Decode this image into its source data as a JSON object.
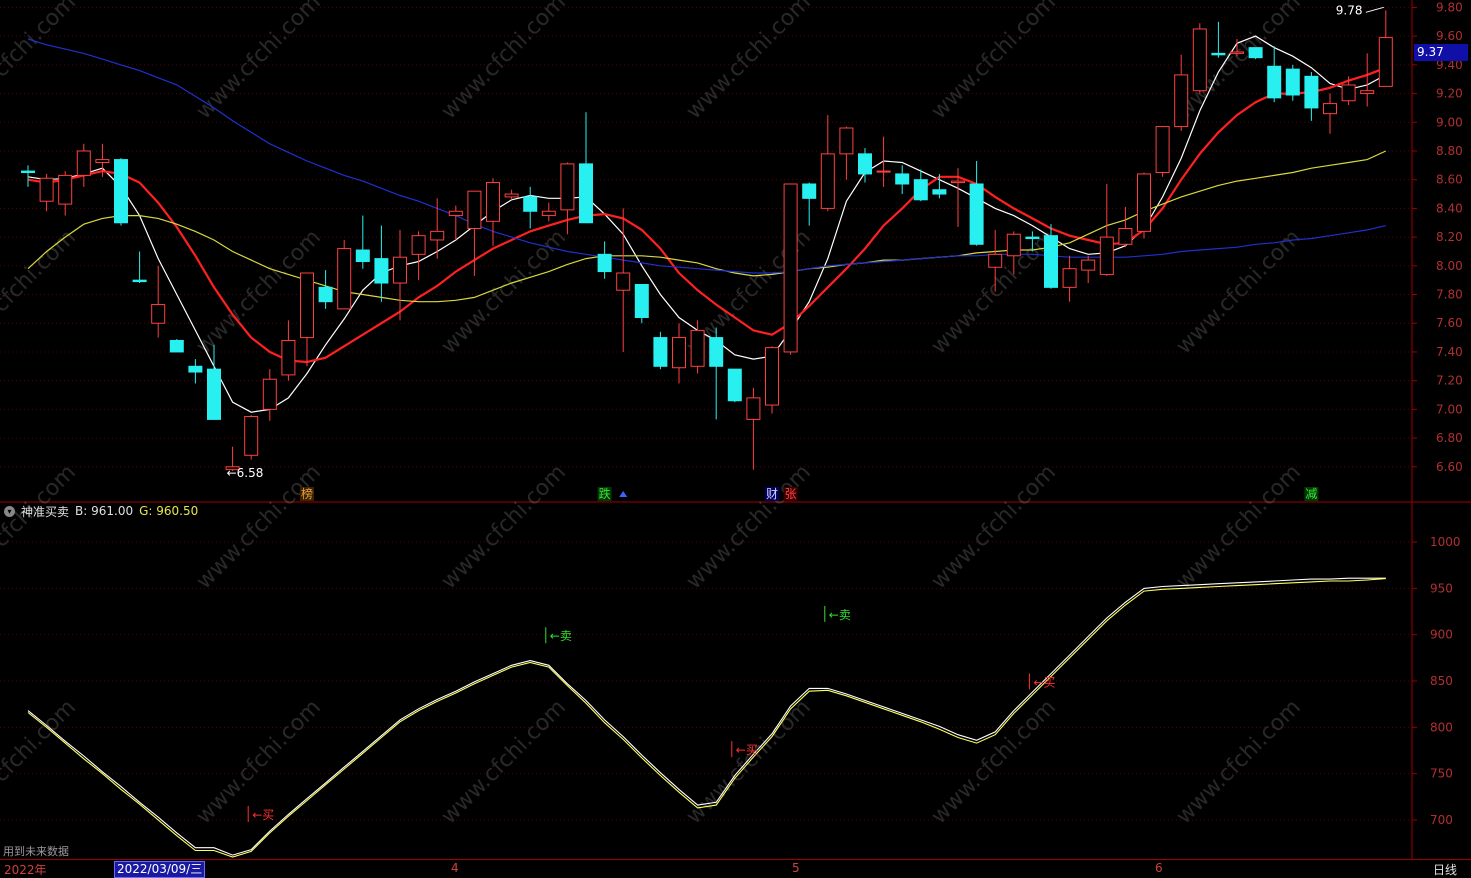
{
  "chart_data": [
    {
      "type": "candlestick",
      "ylim": [
        6.48,
        9.81
      ],
      "yticks": [
        6.6,
        6.8,
        7.0,
        7.2,
        7.4,
        7.6,
        7.8,
        8.0,
        8.2,
        8.4,
        8.6,
        8.8,
        9.0,
        9.2,
        9.4,
        9.6,
        9.8
      ],
      "last_price_label": "9.37",
      "high_annotation": "9.78",
      "low_annotation": "←6.58",
      "candles": [
        [
          8.66,
          8.65,
          8.7,
          8.55
        ],
        [
          8.45,
          8.61,
          8.64,
          8.38
        ],
        [
          8.43,
          8.63,
          8.66,
          8.35
        ],
        [
          8.63,
          8.8,
          8.85,
          8.55
        ],
        [
          8.72,
          8.74,
          8.85,
          8.62
        ],
        [
          8.74,
          8.3,
          8.75,
          8.28
        ],
        [
          7.9,
          7.89,
          8.1,
          7.88
        ],
        [
          7.6,
          7.73,
          8.0,
          7.5
        ],
        [
          7.48,
          7.4,
          7.49,
          7.4
        ],
        [
          7.3,
          7.26,
          7.35,
          7.18
        ],
        [
          7.28,
          6.93,
          7.45,
          6.93
        ],
        [
          6.58,
          6.6,
          6.74,
          6.57
        ],
        [
          6.68,
          6.95,
          6.96,
          6.65
        ],
        [
          7.0,
          7.21,
          7.28,
          6.92
        ],
        [
          7.24,
          7.48,
          7.62,
          7.2
        ],
        [
          7.5,
          7.95,
          7.95,
          7.3
        ],
        [
          7.85,
          7.75,
          7.97,
          7.7
        ],
        [
          7.7,
          8.12,
          8.18,
          7.7
        ],
        [
          8.11,
          8.03,
          8.35,
          7.98
        ],
        [
          8.05,
          7.88,
          8.28,
          7.75
        ],
        [
          7.88,
          8.06,
          8.25,
          7.62
        ],
        [
          8.08,
          8.21,
          8.24,
          7.9
        ],
        [
          8.18,
          8.24,
          8.47,
          8.05
        ],
        [
          8.35,
          8.38,
          8.42,
          8.18
        ],
        [
          8.26,
          8.52,
          8.52,
          7.93
        ],
        [
          8.31,
          8.58,
          8.61,
          8.14
        ],
        [
          8.48,
          8.5,
          8.53,
          8.46
        ],
        [
          8.48,
          8.38,
          8.55,
          8.26
        ],
        [
          8.35,
          8.38,
          8.44,
          8.31
        ],
        [
          8.39,
          8.71,
          8.72,
          8.22
        ],
        [
          8.71,
          8.3,
          9.07,
          8.3
        ],
        [
          8.08,
          7.96,
          8.17,
          7.91
        ],
        [
          7.83,
          7.95,
          8.4,
          7.4
        ],
        [
          7.87,
          7.64,
          7.87,
          7.6
        ],
        [
          7.5,
          7.3,
          7.54,
          7.28
        ],
        [
          7.29,
          7.5,
          7.6,
          7.18
        ],
        [
          7.3,
          7.55,
          7.62,
          7.25
        ],
        [
          7.5,
          7.3,
          7.57,
          6.93
        ],
        [
          7.28,
          7.06,
          7.28,
          7.05
        ],
        [
          6.93,
          7.08,
          7.15,
          6.58
        ],
        [
          7.03,
          7.43,
          7.44,
          6.97
        ],
        [
          7.4,
          8.57,
          8.57,
          7.38
        ],
        [
          8.57,
          8.47,
          8.58,
          8.28
        ],
        [
          8.4,
          8.78,
          9.05,
          8.38
        ],
        [
          8.78,
          8.96,
          8.97,
          8.6
        ],
        [
          8.78,
          8.64,
          8.82,
          8.58
        ],
        [
          8.66,
          8.66,
          8.9,
          8.55
        ],
        [
          8.64,
          8.57,
          8.7,
          8.5
        ],
        [
          8.6,
          8.46,
          8.67,
          8.45
        ],
        [
          8.53,
          8.5,
          8.64,
          8.47
        ],
        [
          8.58,
          8.59,
          8.68,
          8.27
        ],
        [
          8.57,
          8.15,
          8.73,
          8.14
        ],
        [
          7.99,
          8.08,
          8.25,
          7.82
        ],
        [
          8.07,
          8.22,
          8.24,
          7.94
        ],
        [
          8.2,
          8.19,
          8.24,
          8.1
        ],
        [
          8.21,
          7.85,
          8.29,
          7.84
        ],
        [
          7.85,
          7.98,
          8.07,
          7.75
        ],
        [
          7.97,
          8.04,
          8.07,
          7.88
        ],
        [
          7.94,
          8.2,
          8.57,
          7.93
        ],
        [
          8.15,
          8.26,
          8.41,
          8.13
        ],
        [
          8.24,
          8.64,
          8.65,
          8.19
        ],
        [
          8.65,
          8.97,
          8.97,
          8.62
        ],
        [
          8.97,
          9.33,
          9.47,
          8.94
        ],
        [
          9.22,
          9.65,
          9.69,
          9.2
        ],
        [
          9.48,
          9.47,
          9.7,
          9.45
        ],
        [
          9.48,
          9.49,
          9.58,
          9.46
        ],
        [
          9.52,
          9.45,
          9.52,
          9.44
        ],
        [
          9.39,
          9.17,
          9.53,
          9.14
        ],
        [
          9.37,
          9.19,
          9.4,
          9.15
        ],
        [
          9.32,
          9.1,
          9.35,
          9.01
        ],
        [
          9.06,
          9.13,
          9.2,
          8.92
        ],
        [
          9.15,
          9.26,
          9.32,
          9.12
        ],
        [
          9.2,
          9.22,
          9.48,
          9.11
        ],
        [
          9.25,
          9.59,
          9.78,
          9.25
        ]
      ],
      "series": [
        {
          "color": "#ffffff",
          "values": [
            8.62,
            8.6,
            8.61,
            8.64,
            8.68,
            8.55,
            8.35,
            8.05,
            7.8,
            7.55,
            7.3,
            7.05,
            6.98,
            7.0,
            7.08,
            7.25,
            7.45,
            7.63,
            7.83,
            7.95,
            8.0,
            8.03,
            8.1,
            8.18,
            8.28,
            8.38,
            8.46,
            8.49,
            8.47,
            8.47,
            8.48,
            8.36,
            8.22,
            8.0,
            7.8,
            7.64,
            7.55,
            7.48,
            7.38,
            7.35,
            7.37,
            7.55,
            7.75,
            8.05,
            8.45,
            8.65,
            8.73,
            8.72,
            8.66,
            8.6,
            8.54,
            8.47,
            8.4,
            8.35,
            8.28,
            8.2,
            8.12,
            8.08,
            8.09,
            8.14,
            8.26,
            8.48,
            8.75,
            9.08,
            9.35,
            9.55,
            9.6,
            9.52,
            9.46,
            9.38,
            9.27,
            9.23,
            9.26,
            9.33
          ]
        },
        {
          "color": "#ff2020",
          "values": [
            8.6,
            8.58,
            8.6,
            8.63,
            8.66,
            8.64,
            8.58,
            8.44,
            8.27,
            8.07,
            7.85,
            7.66,
            7.5,
            7.4,
            7.34,
            7.33,
            7.36,
            7.44,
            7.52,
            7.6,
            7.68,
            7.78,
            7.86,
            7.96,
            8.04,
            8.12,
            8.18,
            8.24,
            8.28,
            8.32,
            8.35,
            8.36,
            8.33,
            8.25,
            8.12,
            7.95,
            7.83,
            7.73,
            7.64,
            7.55,
            7.52,
            7.6,
            7.72,
            7.85,
            7.98,
            8.12,
            8.28,
            8.4,
            8.53,
            8.62,
            8.62,
            8.57,
            8.48,
            8.4,
            8.33,
            8.26,
            8.21,
            8.18,
            8.15,
            8.16,
            8.25,
            8.4,
            8.6,
            8.78,
            8.93,
            9.05,
            9.14,
            9.2,
            9.2,
            9.21,
            9.24,
            9.29,
            9.33,
            9.38
          ]
        },
        {
          "color": "#d8d840",
          "values": [
            7.98,
            8.1,
            8.2,
            8.29,
            8.33,
            8.35,
            8.35,
            8.33,
            8.29,
            8.24,
            8.18,
            8.1,
            8.04,
            7.98,
            7.94,
            7.9,
            7.86,
            7.82,
            7.8,
            7.78,
            7.76,
            7.75,
            7.75,
            7.76,
            7.78,
            7.83,
            7.88,
            7.92,
            7.96,
            8.01,
            8.05,
            8.07,
            8.07,
            8.07,
            8.06,
            8.04,
            8.02,
            7.98,
            7.95,
            7.93,
            7.94,
            7.96,
            7.98,
            7.99,
            8.01,
            8.02,
            8.04,
            8.04,
            8.05,
            8.06,
            8.07,
            8.09,
            8.1,
            8.11,
            8.11,
            8.13,
            8.16,
            8.22,
            8.28,
            8.32,
            8.38,
            8.43,
            8.48,
            8.52,
            8.56,
            8.59,
            8.61,
            8.63,
            8.65,
            8.68,
            8.7,
            8.72,
            8.74,
            8.8
          ]
        },
        {
          "color": "#2030d0",
          "values": [
            9.58,
            9.54,
            9.51,
            9.48,
            9.44,
            9.4,
            9.36,
            9.31,
            9.26,
            9.18,
            9.1,
            9.01,
            8.93,
            8.85,
            8.79,
            8.73,
            8.68,
            8.63,
            8.59,
            8.54,
            8.49,
            8.45,
            8.4,
            8.35,
            8.29,
            8.24,
            8.2,
            8.16,
            8.13,
            8.1,
            8.08,
            8.06,
            8.04,
            8.02,
            8.0,
            7.99,
            7.98,
            7.97,
            7.96,
            7.95,
            7.95,
            7.96,
            7.98,
            8.0,
            8.01,
            8.02,
            8.03,
            8.04,
            8.05,
            8.06,
            8.07,
            8.07,
            8.08,
            8.08,
            8.08,
            8.07,
            8.06,
            8.06,
            8.06,
            8.06,
            8.07,
            8.08,
            8.1,
            8.11,
            8.12,
            8.13,
            8.15,
            8.16,
            8.18,
            8.19,
            8.21,
            8.23,
            8.25,
            8.28
          ]
        }
      ],
      "events": [
        {
          "label": "榜",
          "index": 15,
          "color": "#e8a040",
          "bg": "#3a2200"
        },
        {
          "label": "跌",
          "index": 31,
          "color": "#40e040",
          "bg": "#003a00"
        },
        {
          "label": "财",
          "index": 40,
          "color": "#d0d0ff",
          "bg": "#000060"
        },
        {
          "label": "张",
          "index": 41,
          "color": "#ff4040",
          "bg": "#3a0000"
        },
        {
          "label": "减",
          "index": 69,
          "color": "#40e040",
          "bg": "#003a00"
        }
      ]
    },
    {
      "type": "line",
      "title": "神准买卖",
      "b_label": "B: 961.00",
      "g_label": "G: 960.50",
      "ylim": [
        660,
        1040
      ],
      "yticks": [
        700,
        750,
        800,
        850,
        900,
        950,
        1000
      ],
      "series": [
        {
          "name": "B",
          "color": "#ffffff",
          "values": [
            818,
            802,
            785,
            769,
            752,
            736,
            719,
            703,
            686,
            670,
            670,
            662,
            668,
            688,
            706,
            723,
            740,
            757,
            774,
            791,
            808,
            820,
            830,
            839,
            849,
            858,
            867,
            872,
            867,
            847,
            829,
            808,
            790,
            770,
            751,
            733,
            716,
            719,
            748,
            771,
            793,
            823,
            842,
            842,
            836,
            829,
            822,
            815,
            808,
            801,
            792,
            786,
            795,
            818,
            838,
            858,
            878,
            898,
            918,
            935,
            950,
            952,
            953,
            954,
            955,
            956,
            957,
            958,
            959,
            960,
            960,
            961,
            961,
            961
          ]
        },
        {
          "name": "G",
          "color": "#ffff60",
          "values": [
            816,
            800,
            783,
            766,
            750,
            733,
            717,
            700,
            683,
            667,
            667,
            660,
            666,
            686,
            704,
            721,
            738,
            755,
            772,
            789,
            806,
            818,
            828,
            837,
            847,
            856,
            865,
            870,
            865,
            845,
            826,
            805,
            787,
            767,
            748,
            730,
            713,
            716,
            745,
            768,
            790,
            820,
            839,
            840,
            834,
            827,
            820,
            813,
            806,
            798,
            789,
            783,
            792,
            815,
            835,
            855,
            875,
            895,
            915,
            932,
            947,
            949,
            950,
            951,
            952,
            953,
            954,
            955,
            956,
            957,
            958,
            958,
            959,
            960.5
          ]
        }
      ],
      "signals": [
        {
          "label": "←买",
          "index": 12,
          "value": 700,
          "color": "#ff3030"
        },
        {
          "label": "←卖",
          "index": 28,
          "value": 893,
          "color": "#30e030"
        },
        {
          "label": "←买",
          "index": 38,
          "value": 770,
          "color": "#ff3030"
        },
        {
          "label": "←卖",
          "index": 43,
          "value": 916,
          "color": "#30e030"
        },
        {
          "label": "←买",
          "index": 54,
          "value": 843,
          "color": "#ff3030"
        }
      ]
    }
  ],
  "footer": {
    "future_note": "用到未来数据",
    "year_label": "2022年",
    "date_box": "2022/03/09/三",
    "month_labels": [
      "4",
      "5",
      "6"
    ],
    "period": "日线"
  },
  "watermark": "www.cfchi.com"
}
